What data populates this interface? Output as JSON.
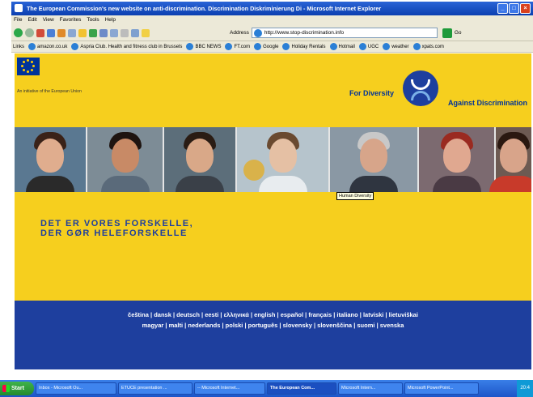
{
  "window": {
    "title": "The European Commission's new website on anti-discrimination. Discrimination Diskriminierung Di - Microsoft Internet Explorer"
  },
  "menu": [
    "File",
    "Edit",
    "View",
    "Favorites",
    "Tools",
    "Help"
  ],
  "address": {
    "label": "Address",
    "url": "http://www.stop-discrimination.info",
    "go": "Go"
  },
  "links_bar": {
    "label": "Links",
    "items": [
      "amazon.co.uk",
      "Aspria Club. Health and fitness club in Brussels",
      "BBC NEWS",
      "FT.com",
      "Google",
      "Holiday Rentals",
      "Hotmail",
      "UGC",
      "weather",
      "xpats.com"
    ]
  },
  "page": {
    "initiative": "An initiative of the European Union",
    "for_diversity": "For Diversity",
    "against_discrimination": "Against Discrimination",
    "tooltip": "Human Diversity",
    "headline": [
      "DET ER VORES FORSKELLE,",
      "DER GØR HELEFORSKELLE"
    ],
    "languages_row1": [
      "čeština",
      "dansk",
      "deutsch",
      "eesti",
      "ελληνικά",
      "english",
      "español",
      "français",
      "italiano",
      "latviski",
      "lietuviškai"
    ],
    "languages_row2": [
      "magyar",
      "malti",
      "nederlands",
      "polski",
      "português",
      "slovensky",
      "slovenščina",
      "suomi",
      "svenska"
    ]
  },
  "taskbar": {
    "start": "Start",
    "tasks": [
      "Inbox - Microsoft Ou...",
      "ETUCE presentation ...",
      "-- Microsoft Internet...",
      "The European Com...",
      "Microsoft Intern...",
      "Microsoft PowerPoint..."
    ],
    "active_index": 3,
    "clock": "20:4"
  }
}
